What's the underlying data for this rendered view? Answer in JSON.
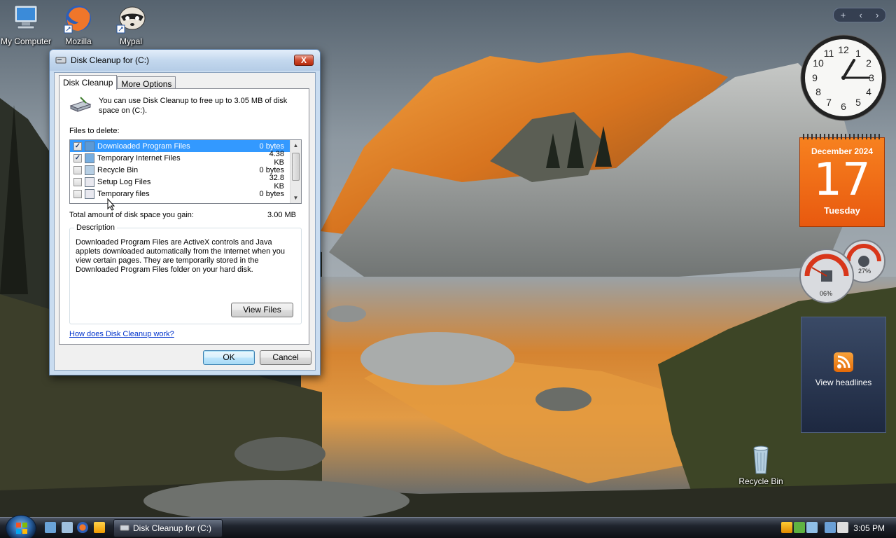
{
  "desktop_icons": [
    {
      "label": "My Computer"
    },
    {
      "label": "Mozilla"
    },
    {
      "label": "Mypal"
    },
    {
      "label": "Recycle Bin"
    }
  ],
  "dialog": {
    "title": "Disk Cleanup for  (C:)",
    "close_label": "X",
    "tabs": [
      {
        "label": "Disk Cleanup",
        "active": true
      },
      {
        "label": "More Options",
        "active": false
      }
    ],
    "intro": "You can use Disk Cleanup to free up to 3.05 MB of disk space on  (C:).",
    "files_label": "Files to delete:",
    "files": [
      {
        "name": "Downloaded Program Files",
        "size": "0 bytes",
        "checked": true,
        "selected": true,
        "icon": "folder-globe-icon"
      },
      {
        "name": "Temporary Internet Files",
        "size": "4.38 KB",
        "checked": true,
        "selected": false,
        "icon": "internet-files-icon"
      },
      {
        "name": "Recycle Bin",
        "size": "0 bytes",
        "checked": false,
        "selected": false,
        "icon": "recycle-bin-icon"
      },
      {
        "name": "Setup Log Files",
        "size": "32.8 KB",
        "checked": false,
        "selected": false,
        "icon": "document-icon"
      },
      {
        "name": "Temporary files",
        "size": "0 bytes",
        "checked": false,
        "selected": false,
        "icon": "document-icon"
      }
    ],
    "total_label": "Total amount of disk space you gain:",
    "total_value": "3.00 MB",
    "description_title": "Description",
    "description_text": "Downloaded Program Files are ActiveX controls and Java applets downloaded automatically from the Internet when you view certain pages. They are temporarily stored in the Downloaded Program Files folder on your hard disk.",
    "view_files_label": "View Files",
    "help_link": "How does Disk Cleanup work?",
    "ok_label": "OK",
    "cancel_label": "Cancel"
  },
  "gadgets": {
    "bar_add": "+",
    "bar_prev": "‹",
    "bar_next": "›",
    "calendar": {
      "month_year": "December 2024",
      "day": "17",
      "weekday": "Tuesday"
    },
    "cpu_meter": {
      "cpu": "06%",
      "memory": "27%"
    },
    "feeds": {
      "label": "View headlines"
    }
  },
  "taskbar": {
    "task_button_label": "Disk Cleanup for  (C:)",
    "clock": "3:05 PM"
  },
  "colors": {
    "selection": "#3399ff",
    "calendar_orange": "#f26f17",
    "link": "#0033cc"
  }
}
